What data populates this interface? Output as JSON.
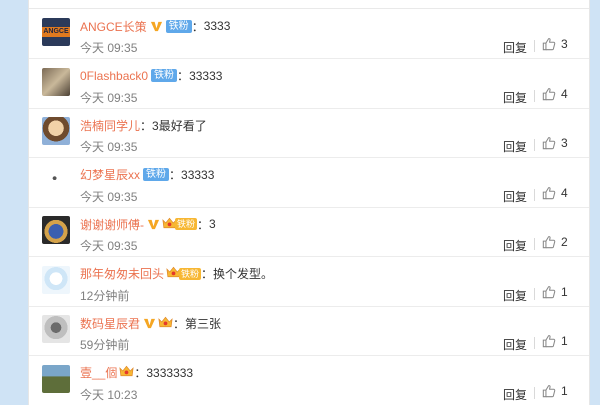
{
  "comments": [
    {
      "username": "ANGCE长策",
      "has_vip": true,
      "badge_iron": "铁粉",
      "badge_gold": "",
      "text": "3333",
      "time": "今天 09:35",
      "reply": "回复",
      "likes": "3",
      "avatar_text": "ANGCE"
    },
    {
      "username": "0Flashback0",
      "has_vip": false,
      "badge_iron": "铁粉",
      "badge_gold": "",
      "text": "33333",
      "time": "今天 09:35",
      "reply": "回复",
      "likes": "4",
      "avatar_text": ""
    },
    {
      "username": "浩楠同学儿",
      "has_vip": false,
      "badge_iron": "",
      "badge_gold": "",
      "text": "3最好看了",
      "time": "今天 09:35",
      "reply": "回复",
      "likes": "3",
      "avatar_text": ""
    },
    {
      "username": "幻梦星辰xx",
      "has_vip": false,
      "badge_iron": "铁粉",
      "badge_gold": "",
      "text": "33333",
      "time": "今天 09:35",
      "reply": "回复",
      "likes": "4",
      "avatar_text": ""
    },
    {
      "username": "谢谢谢师傅-",
      "has_vip": true,
      "badge_iron": "",
      "badge_gold": "铁粉",
      "text": "3",
      "time": "今天 09:35",
      "reply": "回复",
      "likes": "2",
      "avatar_text": ""
    },
    {
      "username": "那年匆匆未回头",
      "has_vip": false,
      "badge_iron": "",
      "badge_gold": "铁粉",
      "text": "换个发型。",
      "time": "12分钟前",
      "reply": "回复",
      "likes": "1",
      "avatar_text": ""
    },
    {
      "username": "数码星辰君",
      "has_vip": true,
      "badge_iron": "",
      "badge_gold": "gold",
      "text": "第三张",
      "time": "59分钟前",
      "reply": "回复",
      "likes": "1",
      "avatar_text": ""
    },
    {
      "username": "壹__個",
      "has_vip": false,
      "badge_iron": "",
      "badge_gold": "gold",
      "text": "3333333",
      "time": "今天 10:23",
      "reply": "回复",
      "likes": "1",
      "avatar_text": ""
    }
  ],
  "colors": {
    "username": "#eb7350",
    "iron_badge": "#5fa8ea",
    "gold_badge": "#f7b733",
    "vip": "#f5a623",
    "background": "#cfe3f5"
  }
}
